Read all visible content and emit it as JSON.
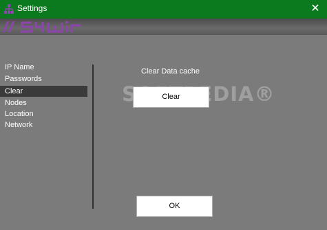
{
  "window": {
    "title": "Settings",
    "close_glyph": "✕",
    "icon": "tree-network-icon"
  },
  "banner": {
    "logo_text": "s4wir",
    "accent_color": "#8e44ad"
  },
  "nav": {
    "items": [
      {
        "label": "IP Name",
        "selected": false
      },
      {
        "label": "Passwords",
        "selected": false
      },
      {
        "label": "Clear",
        "selected": true
      },
      {
        "label": "Nodes",
        "selected": false
      },
      {
        "label": "Location",
        "selected": false
      },
      {
        "label": "Network",
        "selected": false
      }
    ]
  },
  "main": {
    "section_label": "Clear Data cache",
    "clear_button": "Clear"
  },
  "footer": {
    "ok_button": "OK"
  },
  "watermark": {
    "text": "SOFTPEDIA®"
  },
  "colors": {
    "titlebar": "#0b7a1f",
    "background": "#7b7b7b",
    "selected": "#3a3a3a"
  }
}
